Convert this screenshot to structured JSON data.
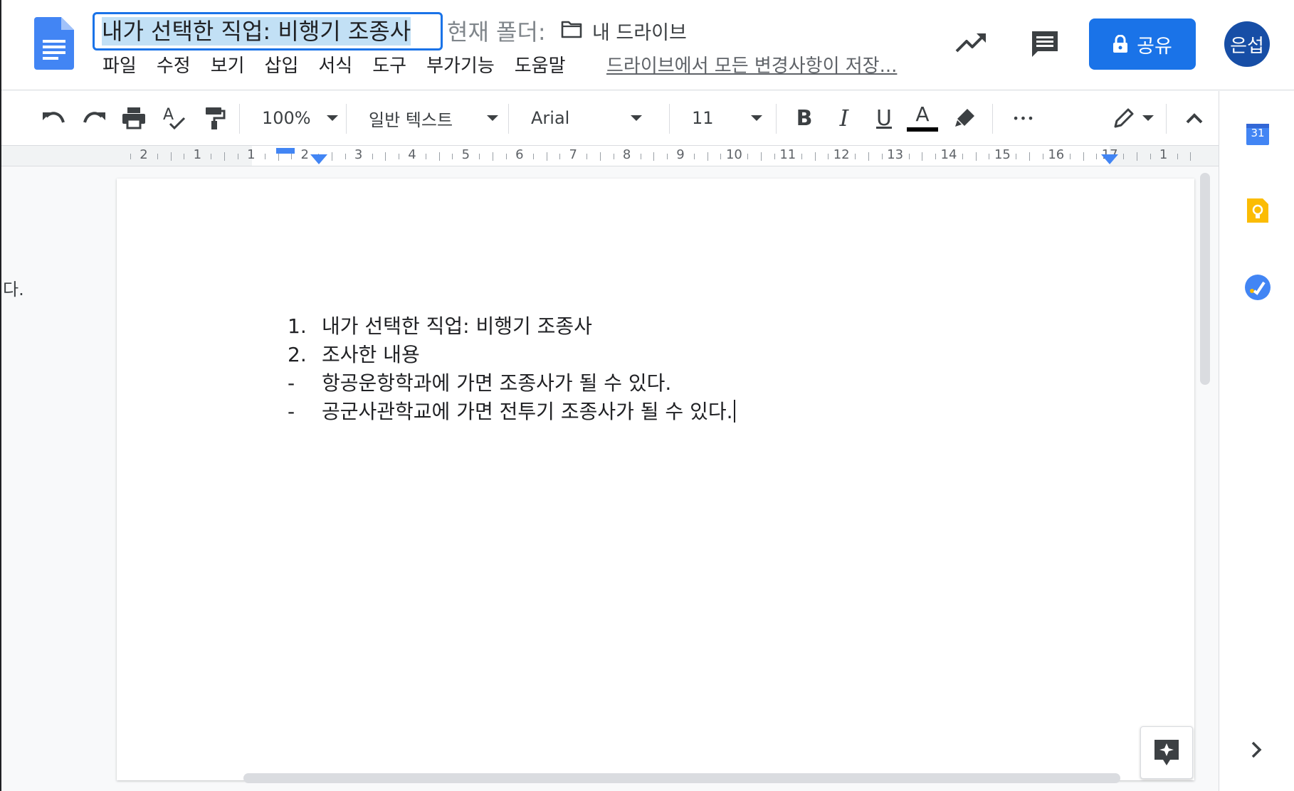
{
  "header": {
    "doc_title": "내가 선택한 직업: 비행기 조종사",
    "folder_label": "현재 폴더:",
    "folder_name": "내 드라이브",
    "save_status": "드라이브에서 모든 변경사항이 저장...",
    "share_label": "공유",
    "avatar_text": "은섭"
  },
  "menu": [
    "파일",
    "수정",
    "보기",
    "삽입",
    "서식",
    "도구",
    "부가기능",
    "도움말"
  ],
  "toolbar": {
    "zoom": "100%",
    "style": "일반 텍스트",
    "font": "Arial",
    "font_size": "11",
    "bold": "B",
    "italic": "I",
    "underline": "U",
    "text_color_glyph": "A",
    "more": "•••"
  },
  "ruler": {
    "numbers": [
      "2",
      "1",
      "1",
      "2",
      "3",
      "4",
      "5",
      "6",
      "7",
      "8",
      "9",
      "10",
      "11",
      "12",
      "13",
      "14",
      "15",
      "16",
      "17",
      "1"
    ]
  },
  "canvas": {
    "left_fragment": "다."
  },
  "document": {
    "lines": [
      {
        "marker": "1.",
        "text": "내가 선택한 직업: 비행기 조종사"
      },
      {
        "marker": "2.",
        "text": "조사한 내용"
      },
      {
        "marker": "-",
        "text": "항공운항학과에 가면 조종사가 될 수 있다."
      },
      {
        "marker": "-",
        "text": "공군사관학교에 가면 전투기 조종사가 될 수 있다."
      }
    ]
  },
  "side_panel": {
    "calendar_day": "31"
  },
  "icons": {
    "docs_logo": "docs-logo-icon",
    "activity": "trending-up-icon",
    "comments": "comment-icon",
    "lock": "lock-icon",
    "explore": "explore-star-icon"
  },
  "colors": {
    "accent": "#1a73e8",
    "avatar_bg": "#174ea6",
    "title_highlight": "#c2e0f5",
    "keep_yellow": "#fbbc04"
  }
}
